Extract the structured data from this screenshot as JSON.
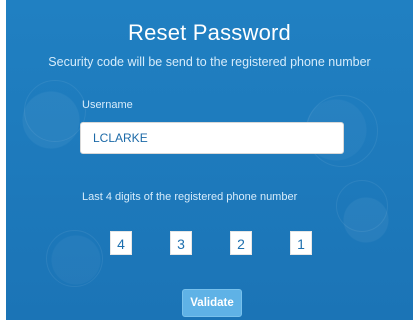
{
  "title": "Reset Password",
  "subtitle": "Security code will be send to the registered phone number",
  "username": {
    "label": "Username",
    "value": "LCLARKE"
  },
  "phone_digits": {
    "label": "Last 4 digits of the registered phone number",
    "digits": [
      "4",
      "3",
      "2",
      "1"
    ]
  },
  "validate_button": {
    "label": "Validate"
  },
  "colors": {
    "panel_background": "#1f7bbd",
    "button_background": "#5fb2e6",
    "input_background": "#ffffff"
  }
}
